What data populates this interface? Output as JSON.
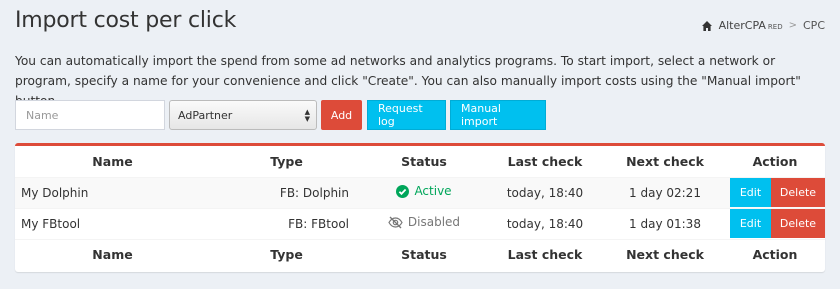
{
  "header": {
    "title": "Import cost per click",
    "breadcrumb": {
      "app": "AlterCPA",
      "app_suffix": "RED",
      "current": "CPC"
    }
  },
  "description": "You can automatically import the spend from some ad networks and analytics programs. To start import, select a network or program, specify a name for your convenience and click \"Create\". You can also manually import costs using the \"Manual import\" button.",
  "toolbar": {
    "name_placeholder": "Name",
    "network_selected": "AdPartner",
    "add_label": "Add",
    "request_log_label": "Request log",
    "manual_import_label": "Manual import"
  },
  "table": {
    "headers": {
      "name": "Name",
      "type": "Type",
      "status": "Status",
      "last_check": "Last check",
      "next_check": "Next check",
      "action": "Action"
    },
    "rows": [
      {
        "name": "My Dolphin",
        "type": "FB: Dolphin",
        "status": "Active",
        "last_check": "today, 18:40",
        "next_check": "1 day 02:21",
        "edit": "Edit",
        "delete": "Delete"
      },
      {
        "name": "My FBtool",
        "type": "FB: FBtool",
        "status": "Disabled",
        "last_check": "today, 18:40",
        "next_check": "1 day 01:38",
        "edit": "Edit",
        "delete": "Delete"
      }
    ]
  },
  "colors": {
    "danger": "#dd4b39",
    "info": "#00c0ef",
    "success": "#00a65a",
    "background": "#ecf0f5"
  },
  "icons": {
    "breadcrumb": "home-icon",
    "active": "check-circle-icon",
    "disabled": "eye-slash-icon"
  }
}
